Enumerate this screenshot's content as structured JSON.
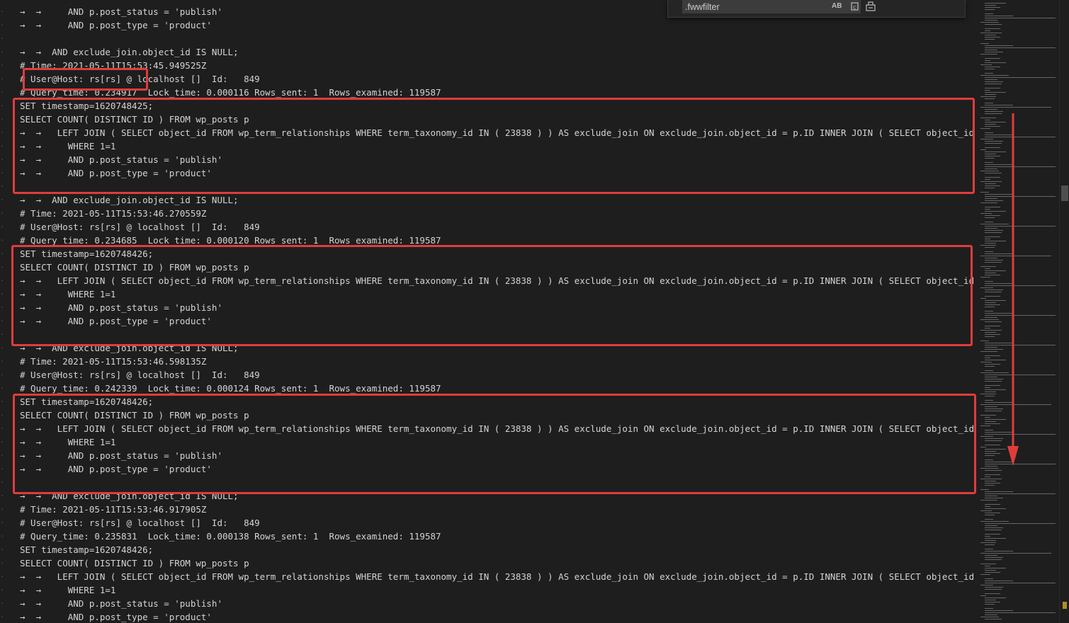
{
  "find": {
    "query": ".fwwfilter",
    "match_case_label": "AB"
  },
  "lines": [
    {
      "text": "→  →     AND p.post_status = 'publish'"
    },
    {
      "text": "→  →     AND p.post_type = 'product'"
    },
    {
      "text": ""
    },
    {
      "text": "→  →  AND exclude_join.object_id IS NULL;"
    },
    {
      "text": "# Time: 2021-05-11T15:53:45.949525Z"
    },
    {
      "text": "# User@Host: rs[rs] @ localhost []  Id:   849"
    },
    {
      "text": "# Query_time: 0.234917  Lock_time: 0.000116 Rows_sent: 1  Rows_examined: 119587"
    },
    {
      "text": "SET timestamp=1620748425;"
    },
    {
      "text": "SELECT COUNT( DISTINCT ID ) FROM wp_posts p"
    },
    {
      "text": "→  →   LEFT JOIN ( SELECT object_id FROM wp_term_relationships WHERE term_taxonomy_id IN ( 23838 ) ) AS exclude_join ON exclude_join.object_id = p.ID INNER JOIN ( SELECT object_id FROM"
    },
    {
      "text": "→  →     WHERE 1=1"
    },
    {
      "text": "→  →     AND p.post_status = 'publish'"
    },
    {
      "text": "→  →     AND p.post_type = 'product'"
    },
    {
      "text": ""
    },
    {
      "text": "→  →  AND exclude_join.object_id IS NULL;"
    },
    {
      "text": "# Time: 2021-05-11T15:53:46.270559Z"
    },
    {
      "text": "# User@Host: rs[rs] @ localhost []  Id:   849"
    },
    {
      "text": "# Query_time: 0.234685  Lock_time: 0.000120 Rows_sent: 1  Rows_examined: 119587"
    },
    {
      "text": "SET timestamp=1620748426;"
    },
    {
      "text": "SELECT COUNT( DISTINCT ID ) FROM wp_posts p"
    },
    {
      "text": "→  →   LEFT JOIN ( SELECT object_id FROM wp_term_relationships WHERE term_taxonomy_id IN ( 23838 ) ) AS exclude_join ON exclude_join.object_id = p.ID INNER JOIN ( SELECT object_id FROM"
    },
    {
      "text": "→  →     WHERE 1=1"
    },
    {
      "text": "→  →     AND p.post_status = 'publish'"
    },
    {
      "text": "→  →     AND p.post_type = 'product'"
    },
    {
      "text": ""
    },
    {
      "text": "→  →  AND exclude_join.object_id IS NULL;"
    },
    {
      "text": "# Time: 2021-05-11T15:53:46.598135Z"
    },
    {
      "text": "# User@Host: rs[rs] @ localhost []  Id:   849"
    },
    {
      "text": "# Query_time: 0.242339  Lock_time: 0.000124 Rows_sent: 1  Rows_examined: 119587"
    },
    {
      "text": "SET timestamp=1620748426;"
    },
    {
      "text": "SELECT COUNT( DISTINCT ID ) FROM wp_posts p"
    },
    {
      "text": "→  →   LEFT JOIN ( SELECT object_id FROM wp_term_relationships WHERE term_taxonomy_id IN ( 23838 ) ) AS exclude_join ON exclude_join.object_id = p.ID INNER JOIN ( SELECT object_id FROM"
    },
    {
      "text": "→  →     WHERE 1=1"
    },
    {
      "text": "→  →     AND p.post_status = 'publish'"
    },
    {
      "text": "→  →     AND p.post_type = 'product'"
    },
    {
      "text": ""
    },
    {
      "text": "→  →  AND exclude_join.object_id IS NULL;"
    },
    {
      "text": "# Time: 2021-05-11T15:53:46.917905Z"
    },
    {
      "text": "# User@Host: rs[rs] @ localhost []  Id:   849"
    },
    {
      "text": "# Query_time: 0.235831  Lock_time: 0.000138 Rows_sent: 1  Rows_examined: 119587"
    },
    {
      "text": "SET timestamp=1620748426;"
    },
    {
      "text": "SELECT COUNT( DISTINCT ID ) FROM wp_posts p"
    },
    {
      "text": "→  →   LEFT JOIN ( SELECT object_id FROM wp_term_relationships WHERE term_taxonomy_id IN ( 23838 ) ) AS exclude_join ON exclude_join.object_id = p.ID INNER JOIN ( SELECT object_id FROM"
    },
    {
      "text": "→  →     WHERE 1=1"
    },
    {
      "text": "→  →     AND p.post_status = 'publish'"
    },
    {
      "text": "→  →     AND p.post_type = 'product'"
    }
  ],
  "colors": {
    "background": "#1e1e1e",
    "text": "#d4d4d4",
    "highlight": "#e03c3c"
  }
}
